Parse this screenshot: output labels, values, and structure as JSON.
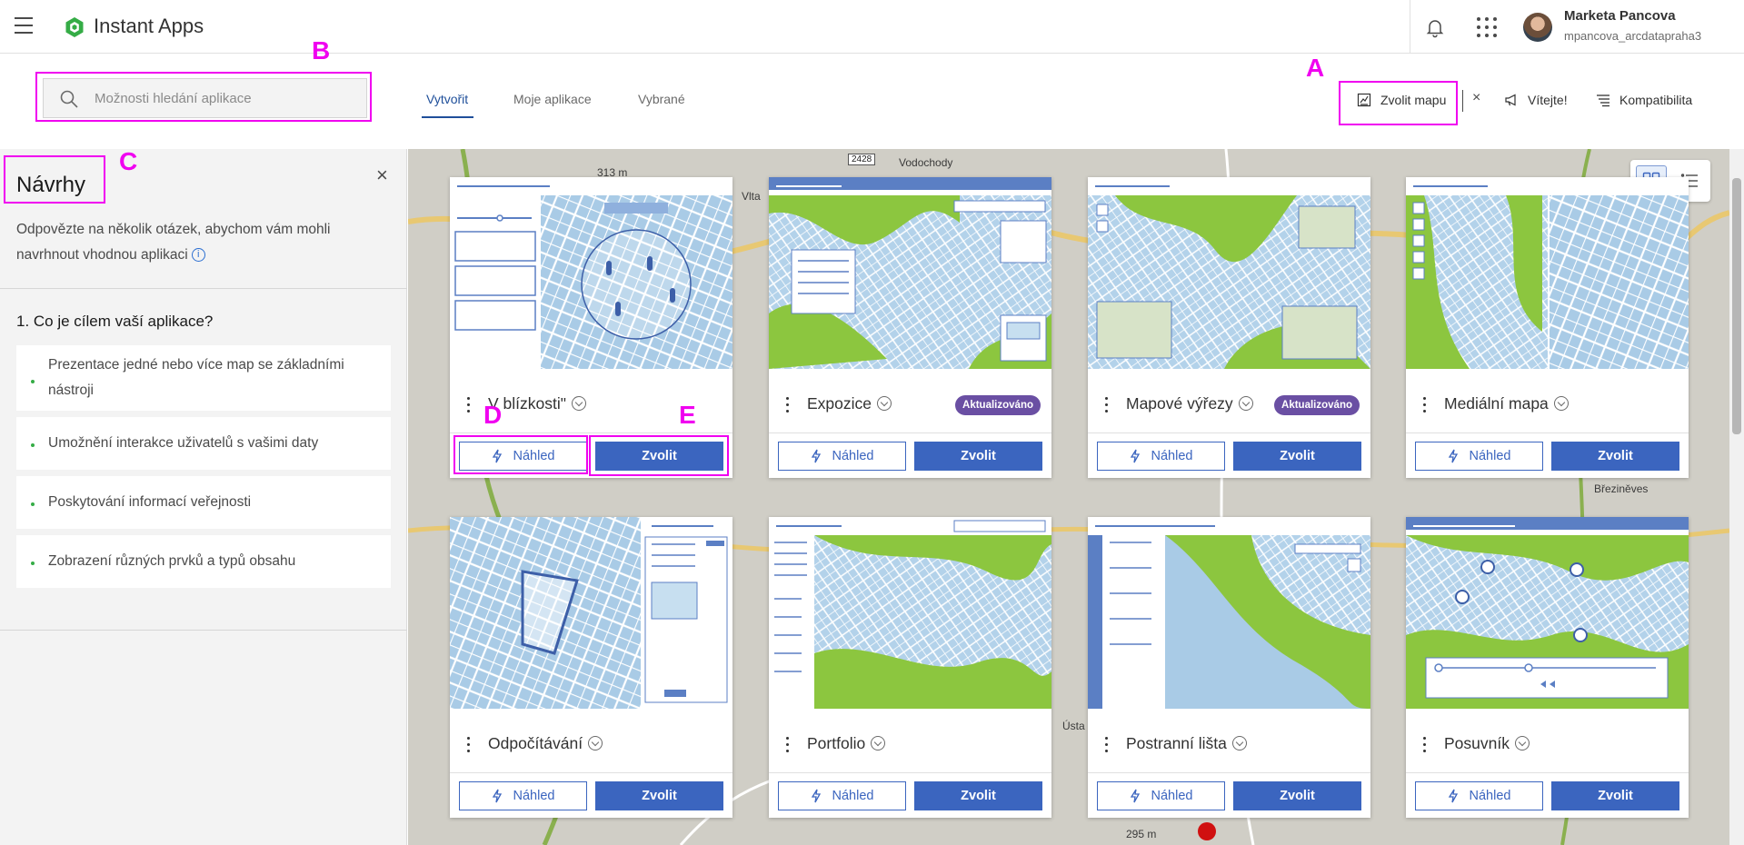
{
  "app": {
    "title": "Instant Apps"
  },
  "user": {
    "name": "Marketa Pancova",
    "id": "mpancova_arcdatapraha3"
  },
  "search": {
    "placeholder": "Možnosti hledání aplikace"
  },
  "tabs": [
    {
      "label": "Vytvořit",
      "active": true
    },
    {
      "label": "Moje aplikace",
      "active": false
    },
    {
      "label": "Vybrané",
      "active": false
    }
  ],
  "toolbar": {
    "choose_map": "Zvolit mapu",
    "close": "×",
    "welcome": "Vítejte!",
    "compatibility": "Kompatibilita"
  },
  "annotations": {
    "a": "A",
    "b": "B",
    "c": "C",
    "d": "D",
    "e": "E"
  },
  "panel": {
    "title": "Návrhy",
    "close": "×",
    "description": "Odpovězte na několik otázek, abychom vám mohli navrhnout vhodnou aplikaci",
    "info": "i",
    "question": "1. Co je cílem vaší aplikace?",
    "options": [
      "Prezentace jedné nebo více map se základními nástroji",
      "Umožnění interakce uživatelů s vašimi daty",
      "Poskytování informací veřejnosti",
      "Zobrazení různých prvků a typů obsahu"
    ]
  },
  "map_labels": {
    "l1": "Vodochody",
    "l2": "2428",
    "l3": "313 m",
    "l4": "Vlta",
    "l5": "Březiněves",
    "l6": "295 m",
    "l7": "Ústa"
  },
  "cards": [
    {
      "title": "V blízkosti\"",
      "badge": "",
      "preview": "Náhled",
      "select": "Zvolit"
    },
    {
      "title": "Expozice",
      "badge": "Aktualizováno",
      "preview": "Náhled",
      "select": "Zvolit"
    },
    {
      "title": "Mapové výřezy",
      "badge": "Aktualizováno",
      "preview": "Náhled",
      "select": "Zvolit"
    },
    {
      "title": "Mediální mapa",
      "badge": "",
      "preview": "Náhled",
      "select": "Zvolit"
    },
    {
      "title": "Odpočítávání",
      "badge": "",
      "preview": "Náhled",
      "select": "Zvolit"
    },
    {
      "title": "Portfolio",
      "badge": "",
      "preview": "Náhled",
      "select": "Zvolit"
    },
    {
      "title": "Postranní lišta",
      "badge": "",
      "preview": "Náhled",
      "select": "Zvolit"
    },
    {
      "title": "Posuvník",
      "badge": "",
      "preview": "Náhled",
      "select": "Zvolit"
    }
  ],
  "colors": {
    "accent": "#3b65bf",
    "badge": "#6a4fa3",
    "annotation": "#f000f0",
    "brand": "#35ac46"
  }
}
